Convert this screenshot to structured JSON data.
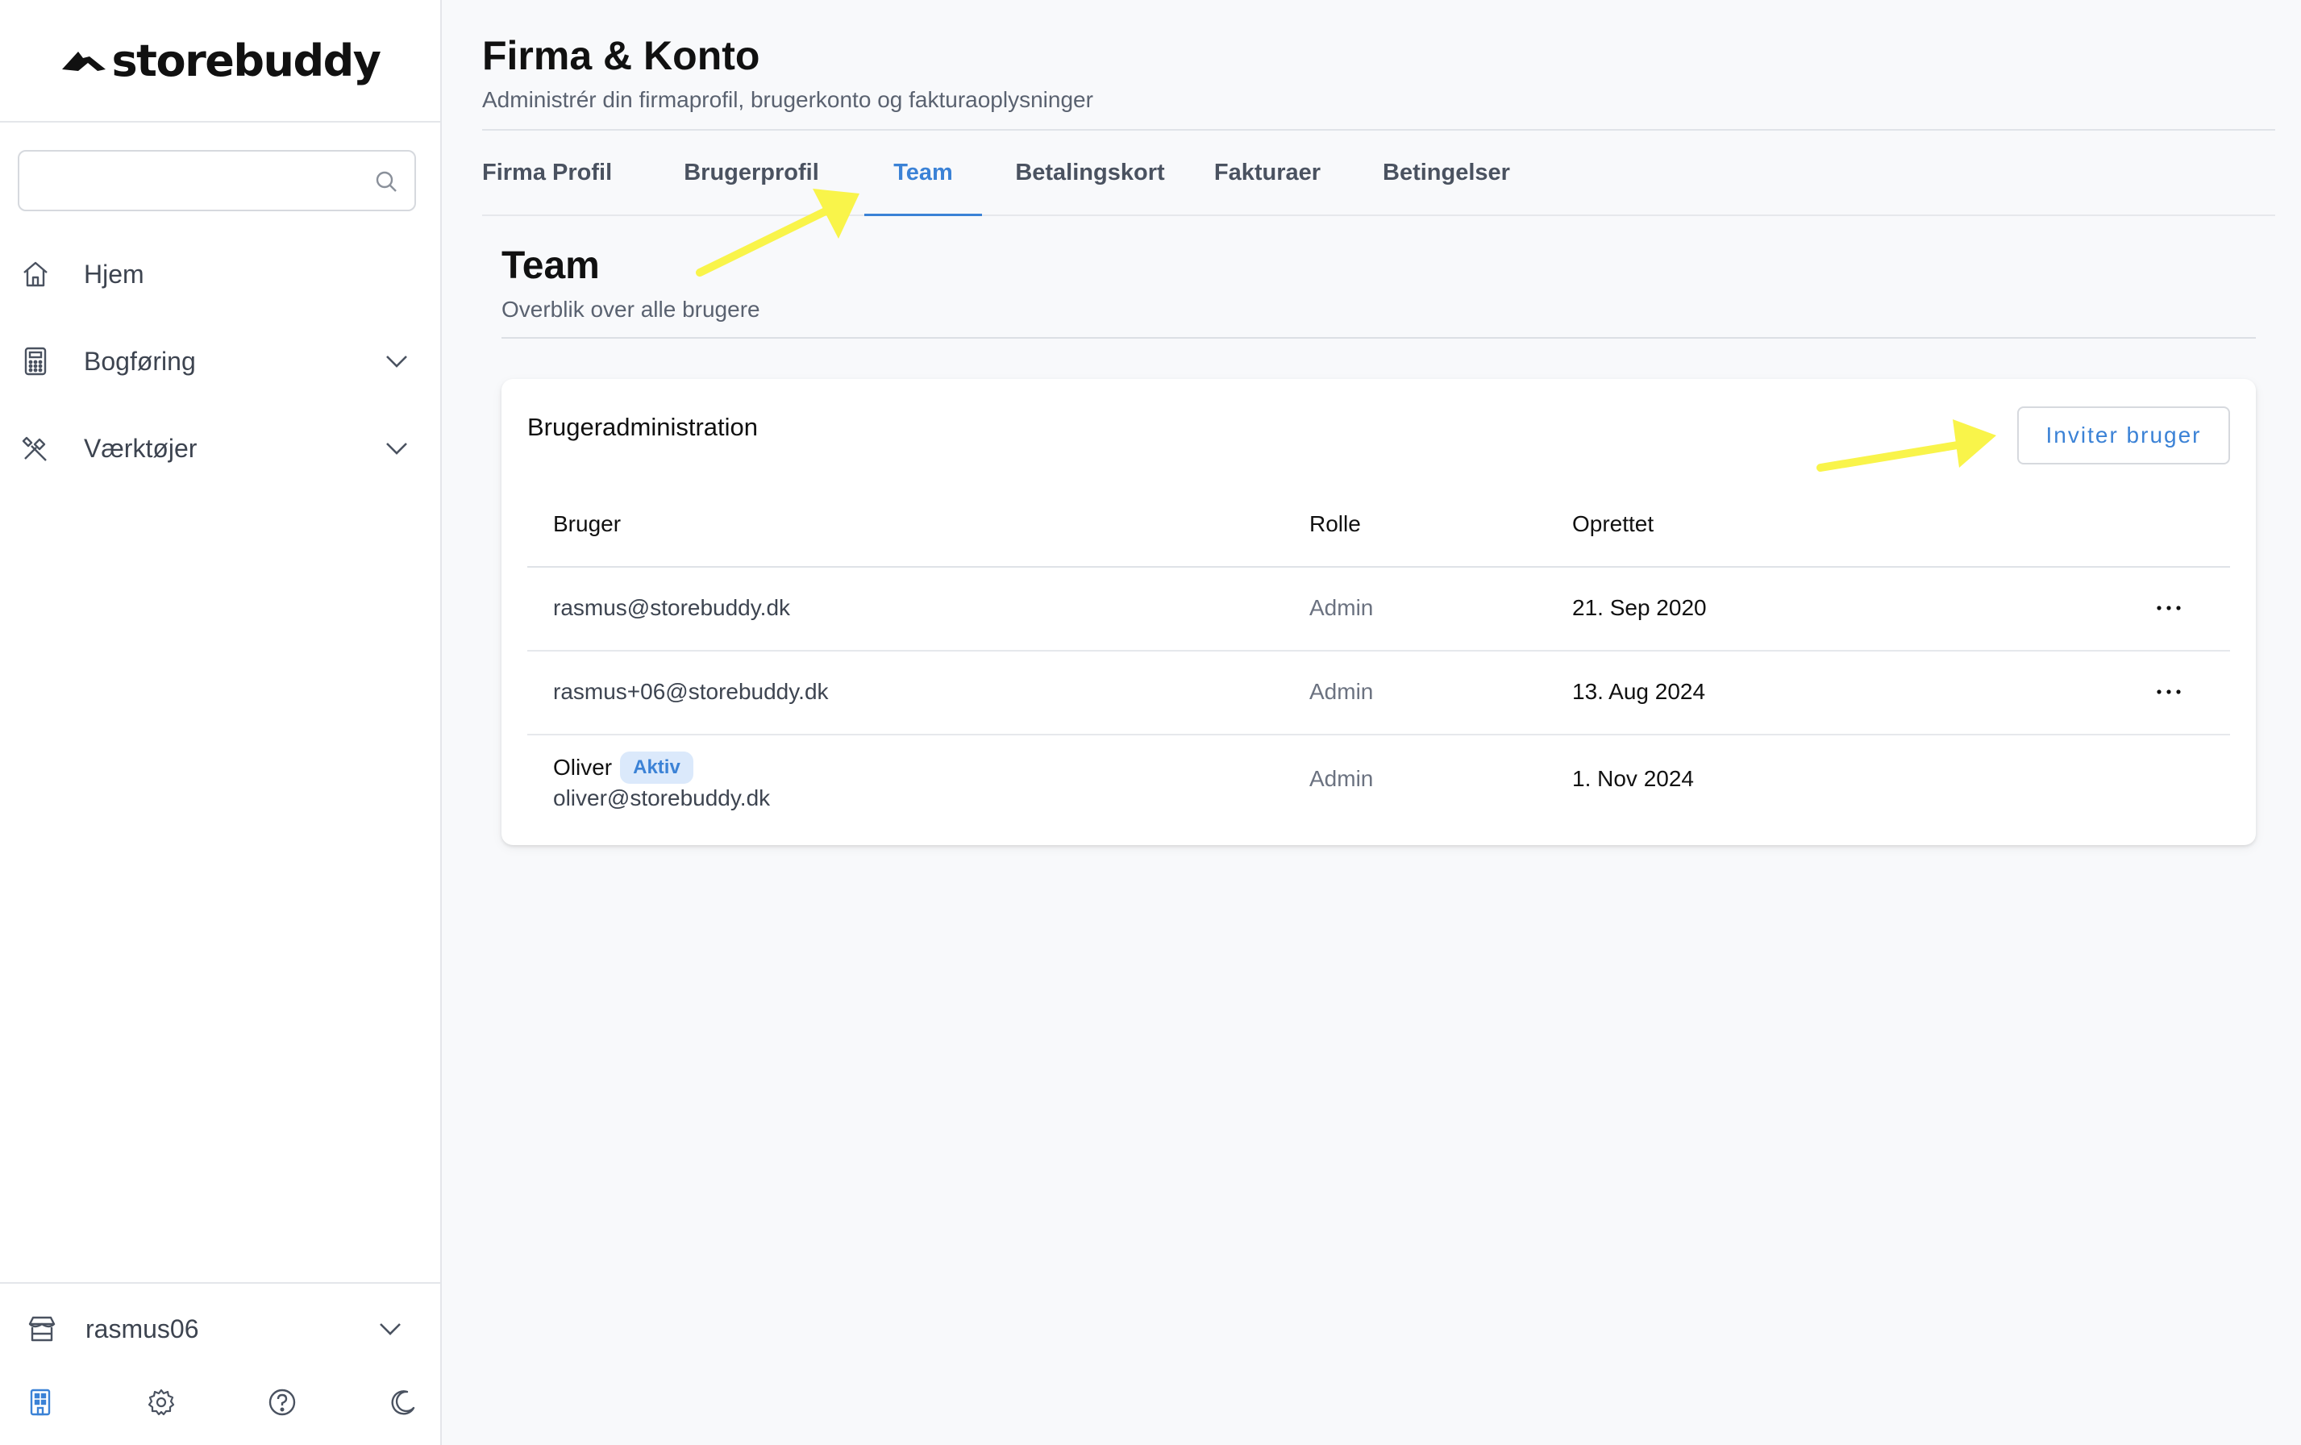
{
  "brand": {
    "name": "storebuddy"
  },
  "sidebar": {
    "search_placeholder": "",
    "items": [
      {
        "label": "Hjem",
        "icon": "home-icon"
      },
      {
        "label": "Bogføring",
        "icon": "calculator-icon"
      },
      {
        "label": "Værktøjer",
        "icon": "tools-icon"
      }
    ],
    "account": {
      "label": "rasmus06",
      "icon": "store-icon"
    },
    "footer_icons": [
      "building-icon",
      "gear-icon",
      "help-icon",
      "moon-icon"
    ]
  },
  "header": {
    "title": "Firma & Konto",
    "subtitle": "Administrér din firmaprofil, brugerkonto og fakturaoplysninger"
  },
  "tabs": [
    {
      "label": "Firma Profil"
    },
    {
      "label": "Brugerprofil"
    },
    {
      "label": "Team",
      "active": true
    },
    {
      "label": "Betalingskort"
    },
    {
      "label": "Fakturaer"
    },
    {
      "label": "Betingelser"
    }
  ],
  "section": {
    "title": "Team",
    "subtitle": "Overblik over alle brugere"
  },
  "card": {
    "title": "Brugeradministration",
    "invite_label": "Inviter bruger",
    "columns": [
      "Bruger",
      "Rolle",
      "Oprettet"
    ],
    "rows": [
      {
        "user": "rasmus@storebuddy.dk",
        "role": "Admin",
        "created": "21. Sep 2020"
      },
      {
        "user": "rasmus+06@storebuddy.dk",
        "role": "Admin",
        "created": "13. Aug 2024"
      },
      {
        "name": "Oliver",
        "badge": "Aktiv",
        "user": "oliver@storebuddy.dk",
        "role": "Admin",
        "created": "1. Nov 2024"
      }
    ]
  },
  "colors": {
    "accent": "#3b82d6",
    "badge_bg": "#dbe9fb",
    "annotation": "#f9f44a"
  }
}
